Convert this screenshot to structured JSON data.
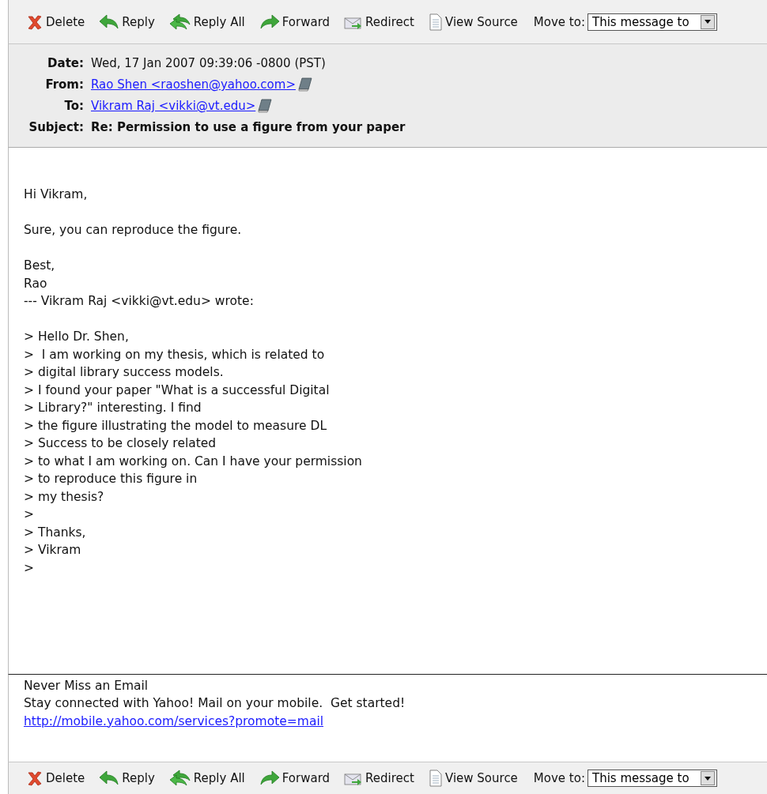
{
  "toolbar_top": {
    "actions": [
      {
        "kind": "delete",
        "label": "Delete"
      },
      {
        "kind": "reply",
        "label": "Reply"
      },
      {
        "kind": "reply_all",
        "label": "Reply All"
      },
      {
        "kind": "forward",
        "label": "Forward"
      },
      {
        "kind": "redirect",
        "label": "Redirect"
      },
      {
        "kind": "source",
        "label": "View Source"
      }
    ],
    "move_label": "Move to:",
    "move_value": "This message to"
  },
  "header": [
    {
      "label": "Date:",
      "value": "Wed, 17 Jan 2007 09:39:06 -0800 (PST)",
      "kind": "text"
    },
    {
      "label": "From:",
      "value": "Rao Shen <raoshen@yahoo.com>",
      "kind": "contact"
    },
    {
      "label": "To:",
      "value": "Vikram Raj <vikki@vt.edu>",
      "kind": "contact"
    },
    {
      "label": "Subject:",
      "value": "Re: Permission to use a figure from your paper",
      "kind": "subject"
    }
  ],
  "body": [
    [
      "Hi Vikram,"
    ],
    [
      "Sure, you can reproduce the figure."
    ],
    [
      "Best,",
      "Rao",
      "--- Vikram Raj <vikki@vt.edu> wrote:"
    ],
    [
      "> Hello Dr. Shen,",
      ">  I am working on my thesis, which is related to",
      "> digital library success models.",
      "> I found your paper \"What is a successful Digital",
      "> Library?\" interesting. I find",
      "> the figure illustrating the model to measure DL",
      "> Success to be closely related",
      "> to what I am working on. Can I have your permission",
      "> to reproduce this figure in",
      "> my thesis?",
      ">",
      "> Thanks,",
      "> Vikram",
      ">"
    ]
  ],
  "footer": {
    "lines": [
      "Never Miss an Email",
      "Stay connected with Yahoo! Mail on your mobile.  Get started!"
    ],
    "link": "http://mobile.yahoo.com/services?promote=mail"
  },
  "toolbar_bottom": {
    "actions": [
      {
        "kind": "delete",
        "label": "Delete"
      },
      {
        "kind": "reply",
        "label": "Reply"
      },
      {
        "kind": "reply_all",
        "label": "Reply All"
      },
      {
        "kind": "forward",
        "label": "Forward"
      },
      {
        "kind": "redirect",
        "label": "Redirect"
      },
      {
        "kind": "source",
        "label": "View Source"
      }
    ],
    "move_label": "Move to:",
    "move_value": "This message to"
  }
}
